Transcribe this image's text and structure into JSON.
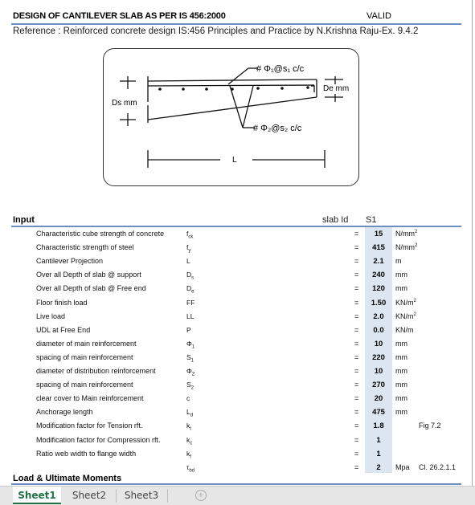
{
  "header": {
    "title": "DESIGN OF CANTILEVER SLAB AS PER IS 456:2000",
    "status": "VALID",
    "reference": "Reference : Reinforced concrete design IS:456 Principles and Practice by N.Krishna Raju-Ex. 9.4.2"
  },
  "figure": {
    "label_top_bar": "# Φ₁@s₁ c/c",
    "label_bottom_bar": "# Φ₂@s₂ c/c",
    "label_support_depth": "Ds mm",
    "label_free_depth": "De mm",
    "label_length": "L"
  },
  "input_section": {
    "title": "Input",
    "slab_id_label": "slab Id",
    "slab_id_value": "S1",
    "rows": [
      {
        "desc": "Characteristic cube strength of concrete",
        "sym": "f",
        "sub": "ck",
        "eq": "=",
        "val": "15",
        "unit": "N/mm",
        "unit_sup": "2",
        "note": ""
      },
      {
        "desc": "Characteristic strength of steel",
        "sym": "f",
        "sub": "y",
        "eq": "=",
        "val": "415",
        "unit": "N/mm",
        "unit_sup": "2",
        "note": ""
      },
      {
        "desc": "Cantilever Projection",
        "sym": "L",
        "sub": "",
        "eq": "=",
        "val": "2.1",
        "unit": "m",
        "unit_sup": "",
        "note": ""
      },
      {
        "desc": "Over all Depth of slab @ support",
        "sym": "D",
        "sub": "s",
        "eq": "=",
        "val": "240",
        "unit": "mm",
        "unit_sup": "",
        "note": ""
      },
      {
        "desc": "Over all Depth of slab @ Free end",
        "sym": "D",
        "sub": "e",
        "eq": "=",
        "val": "120",
        "unit": "mm",
        "unit_sup": "",
        "note": ""
      },
      {
        "desc": "Floor finish load",
        "sym": "FF",
        "sub": "",
        "eq": "=",
        "val": "1.50",
        "unit": "KN/m",
        "unit_sup": "2",
        "note": ""
      },
      {
        "desc": "Live load",
        "sym": "LL",
        "sub": "",
        "eq": "=",
        "val": "2.0",
        "unit": "KN/m",
        "unit_sup": "2",
        "note": ""
      },
      {
        "desc": "UDL at Free End",
        "sym": "P",
        "sub": "",
        "eq": "=",
        "val": "0.0",
        "unit": "KN/m",
        "unit_sup": "",
        "note": ""
      },
      {
        "desc": "diameter of main reinforcement",
        "sym": "Φ",
        "sub": "1",
        "eq": "=",
        "val": "10",
        "unit": "mm",
        "unit_sup": "",
        "note": ""
      },
      {
        "desc": "spacing of main reinforcement",
        "sym": "S",
        "sub": "1",
        "eq": "=",
        "val": "220",
        "unit": "mm",
        "unit_sup": "",
        "note": ""
      },
      {
        "desc": "diameter of distribution reinforcement",
        "sym": "Φ",
        "sub": "2",
        "eq": "=",
        "val": "10",
        "unit": "mm",
        "unit_sup": "",
        "note": ""
      },
      {
        "desc": "spacing of main reinforcement",
        "sym": "S",
        "sub": "2",
        "eq": "=",
        "val": "270",
        "unit": "mm",
        "unit_sup": "",
        "note": ""
      },
      {
        "desc": "clear cover to Main reinforcement",
        "sym": "c",
        "sub": "",
        "eq": "=",
        "val": "20",
        "unit": "mm",
        "unit_sup": "",
        "note": ""
      },
      {
        "desc": "Anchorage length",
        "sym": "L",
        "sub": "d",
        "eq": "=",
        "val": "475",
        "unit": "mm",
        "unit_sup": "",
        "note": ""
      },
      {
        "desc": "Modification factor for Tension rft.",
        "sym": "k",
        "sub": "t",
        "eq": "=",
        "val": "1.8",
        "unit": "",
        "unit_sup": "",
        "note": "Fig 7.2"
      },
      {
        "desc": "Modification factor for Compression rft.",
        "sym": "k",
        "sub": "c",
        "eq": "=",
        "val": "1",
        "unit": "",
        "unit_sup": "",
        "note": ""
      },
      {
        "desc": "Ratio web width to flange width",
        "sym": "k",
        "sub": "f",
        "eq": "=",
        "val": "1",
        "unit": "",
        "unit_sup": "",
        "note": ""
      },
      {
        "desc": "",
        "sym": "τ",
        "sub": "bd",
        "eq": "=",
        "val": "2",
        "unit": "Mpa",
        "unit_sup": "",
        "note": "Cl. 26.2.1.1"
      }
    ]
  },
  "next_section": {
    "title": "Load & Ultimate Moments"
  },
  "tabs": [
    {
      "label": "Sheet1",
      "active": true
    },
    {
      "label": "Sheet2",
      "active": false
    },
    {
      "label": "Sheet3",
      "active": false
    }
  ],
  "add_sheet_icon": "plus-circle-icon",
  "colors": {
    "accent_rule": "#6c8ebf",
    "input_cell_fill": "#dce6f1",
    "active_tab": "#217346"
  }
}
